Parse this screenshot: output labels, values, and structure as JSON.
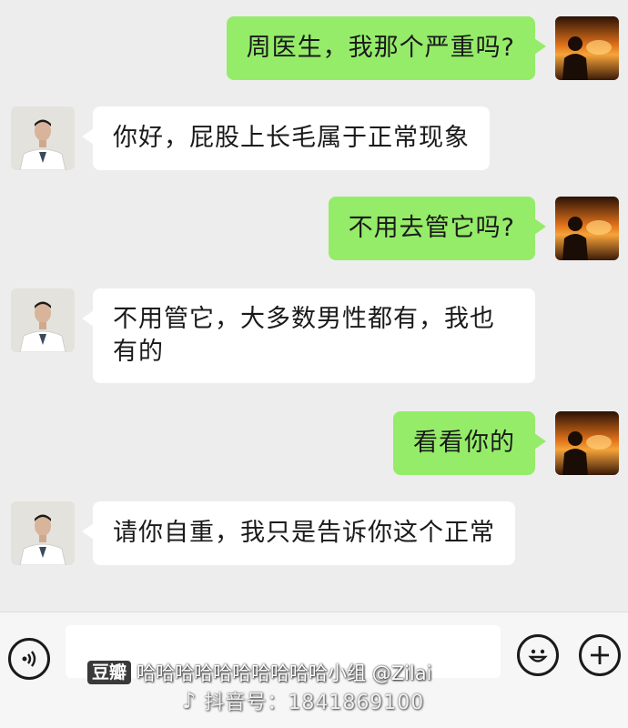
{
  "messages": [
    {
      "sender": "user",
      "text": "周医生，我那个严重吗?"
    },
    {
      "sender": "doctor",
      "text": "你好，屁股上长毛属于正常现象"
    },
    {
      "sender": "user",
      "text": "不用去管它吗?"
    },
    {
      "sender": "doctor",
      "line1": "不用管它，大多数男性都有，我也",
      "line2": "有的"
    },
    {
      "sender": "user",
      "text": "看看你的"
    },
    {
      "sender": "doctor",
      "text": "请你自重，我只是告诉你这个正常"
    }
  ],
  "input_bar": {
    "voice_icon": "voice-icon",
    "emoji_icon": "emoji-icon",
    "plus_icon": "plus-icon",
    "input_value": ""
  },
  "watermark": {
    "badge": "豆瓣",
    "text": "哈哈哈哈哈哈哈哈哈哈小组 @Zilai",
    "douyin_label": "抖音号：1841869100"
  },
  "colors": {
    "background": "#ededed",
    "outgoing_bubble": "#95ec69",
    "incoming_bubble": "#ffffff"
  }
}
